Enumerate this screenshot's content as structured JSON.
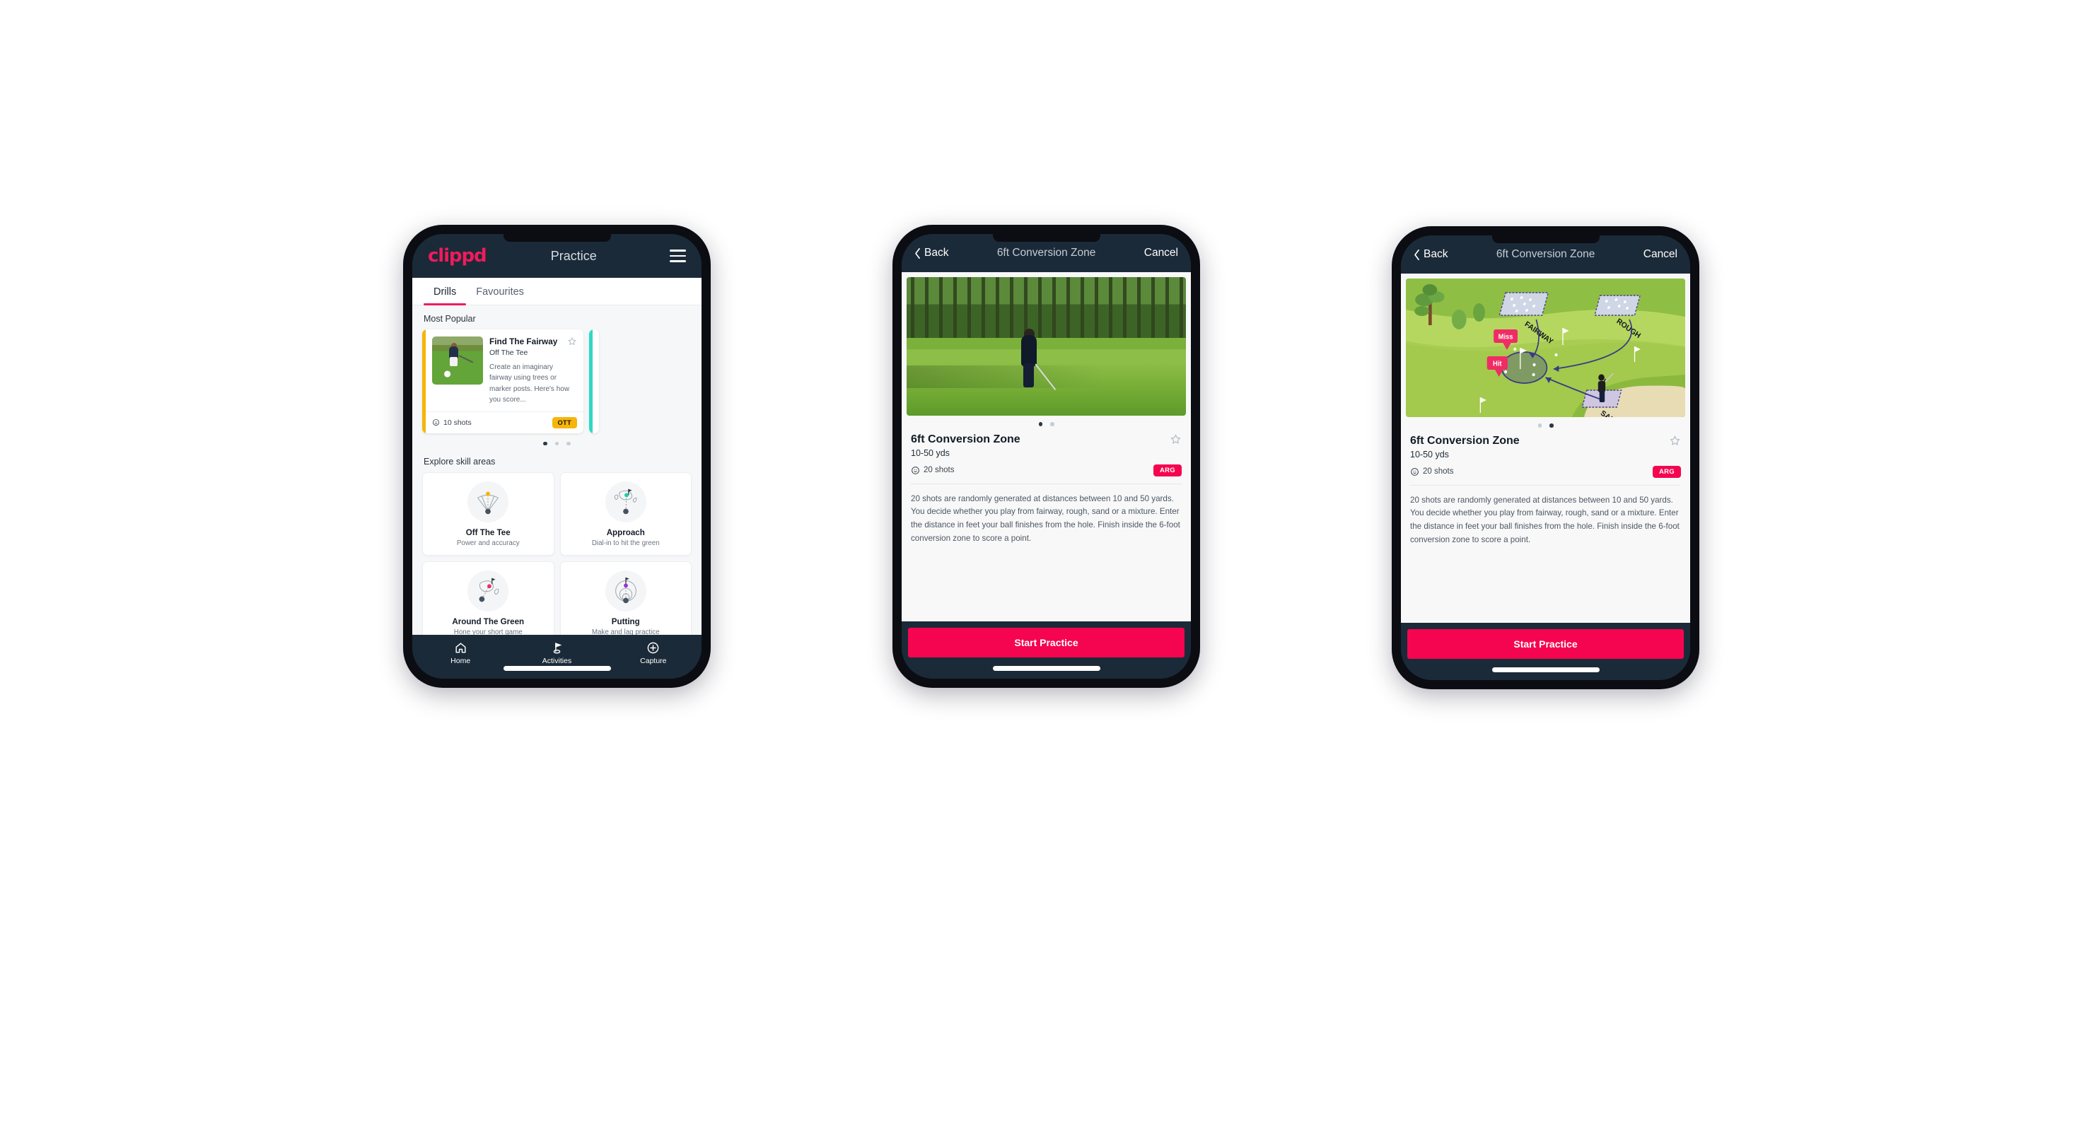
{
  "phone1": {
    "topbar": {
      "logo": "clippd",
      "title": "Practice",
      "menu_icon": "hamburger-icon"
    },
    "tabs": [
      {
        "label": "Drills",
        "active": true
      },
      {
        "label": "Favourites",
        "active": false
      }
    ],
    "section_most_popular": "Most Popular",
    "drill_cards": [
      {
        "name": "Find The Fairway",
        "category": "Off The Tee",
        "description": "Create an imaginary fairway using trees or marker posts. Here's how you score...",
        "shots": "10 shots",
        "pill": "OTT",
        "pill_color": "#f5b50a",
        "accent_color": "#f5b50a"
      },
      {
        "accent_color": "#2fd8c4"
      }
    ],
    "carousel_dots": {
      "count": 3,
      "active_index": 0
    },
    "section_explore": "Explore skill areas",
    "skill_cards": [
      {
        "name": "Off The Tee",
        "desc": "Power and accuracy",
        "icon": "tee-dispersion-icon",
        "dot_color": "#f5b50a"
      },
      {
        "name": "Approach",
        "desc": "Dial-in to hit the green",
        "icon": "green-approach-icon",
        "dot_color": "#1ad1a5"
      },
      {
        "name": "Around The Green",
        "desc": "Hone your short game",
        "icon": "chip-green-icon",
        "dot_color": "#ef2c64"
      },
      {
        "name": "Putting",
        "desc": "Make and lag practice",
        "icon": "putting-rings-icon",
        "dot_color": "#9b2ae0"
      }
    ],
    "bottom_nav": [
      {
        "label": "Home",
        "icon": "home-icon",
        "active": false
      },
      {
        "label": "Activities",
        "icon": "golf-flag-icon",
        "active": true
      },
      {
        "label": "Capture",
        "icon": "plus-circle-icon",
        "active": false
      }
    ]
  },
  "phone2": {
    "topbar": {
      "back": "Back",
      "title": "6ft Conversion Zone",
      "cancel": "Cancel"
    },
    "media_type": "photo",
    "media_alt": "golfer chipping on fairway with pine trees",
    "carousel_dots": {
      "count": 2,
      "active_index": 0
    },
    "detail": {
      "title": "6ft Conversion Zone",
      "range": "10-50 yds",
      "shots": "20 shots",
      "pill": "ARG",
      "pill_color": "#f5054f",
      "description": "20 shots are randomly generated at distances between 10 and 50 yards. You decide whether you play from fairway, rough, sand or a mixture. Enter the distance in feet your ball finishes from the hole. Finish inside the 6-foot conversion zone to score a point."
    },
    "cta": "Start Practice"
  },
  "phone3": {
    "topbar": {
      "back": "Back",
      "title": "6ft Conversion Zone",
      "cancel": "Cancel"
    },
    "media_type": "illustration",
    "illustration": {
      "labels": [
        "FAIRWAY",
        "ROUGH",
        "SAND"
      ],
      "callouts": [
        {
          "text": "Miss",
          "color": "#ef2c64"
        },
        {
          "text": "Hit",
          "color": "#ef2c64"
        }
      ]
    },
    "carousel_dots": {
      "count": 2,
      "active_index": 1
    },
    "detail": {
      "title": "6ft Conversion Zone",
      "range": "10-50 yds",
      "shots": "20 shots",
      "pill": "ARG",
      "pill_color": "#f5054f",
      "description": "20 shots are randomly generated at distances between 10 and 50 yards. You decide whether you play from fairway, rough, sand or a mixture. Enter the distance in feet your ball finishes from the hole. Finish inside the 6-foot conversion zone to score a point."
    },
    "cta": "Start Practice"
  }
}
